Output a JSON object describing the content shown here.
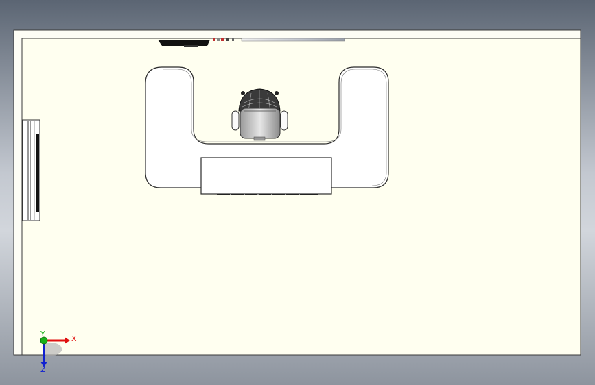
{
  "colors": {
    "background_top": "#5b6573",
    "background_mid": "#c3c8d0",
    "floor": "#fffff0",
    "outline": "#2b2b2b",
    "axis_x": "#e01010",
    "axis_y": "#18b018",
    "axis_z": "#1020d0"
  },
  "axis": {
    "x_label": "X",
    "y_label": "Y",
    "z_label": "Z"
  },
  "view": {
    "orientation": "top"
  }
}
